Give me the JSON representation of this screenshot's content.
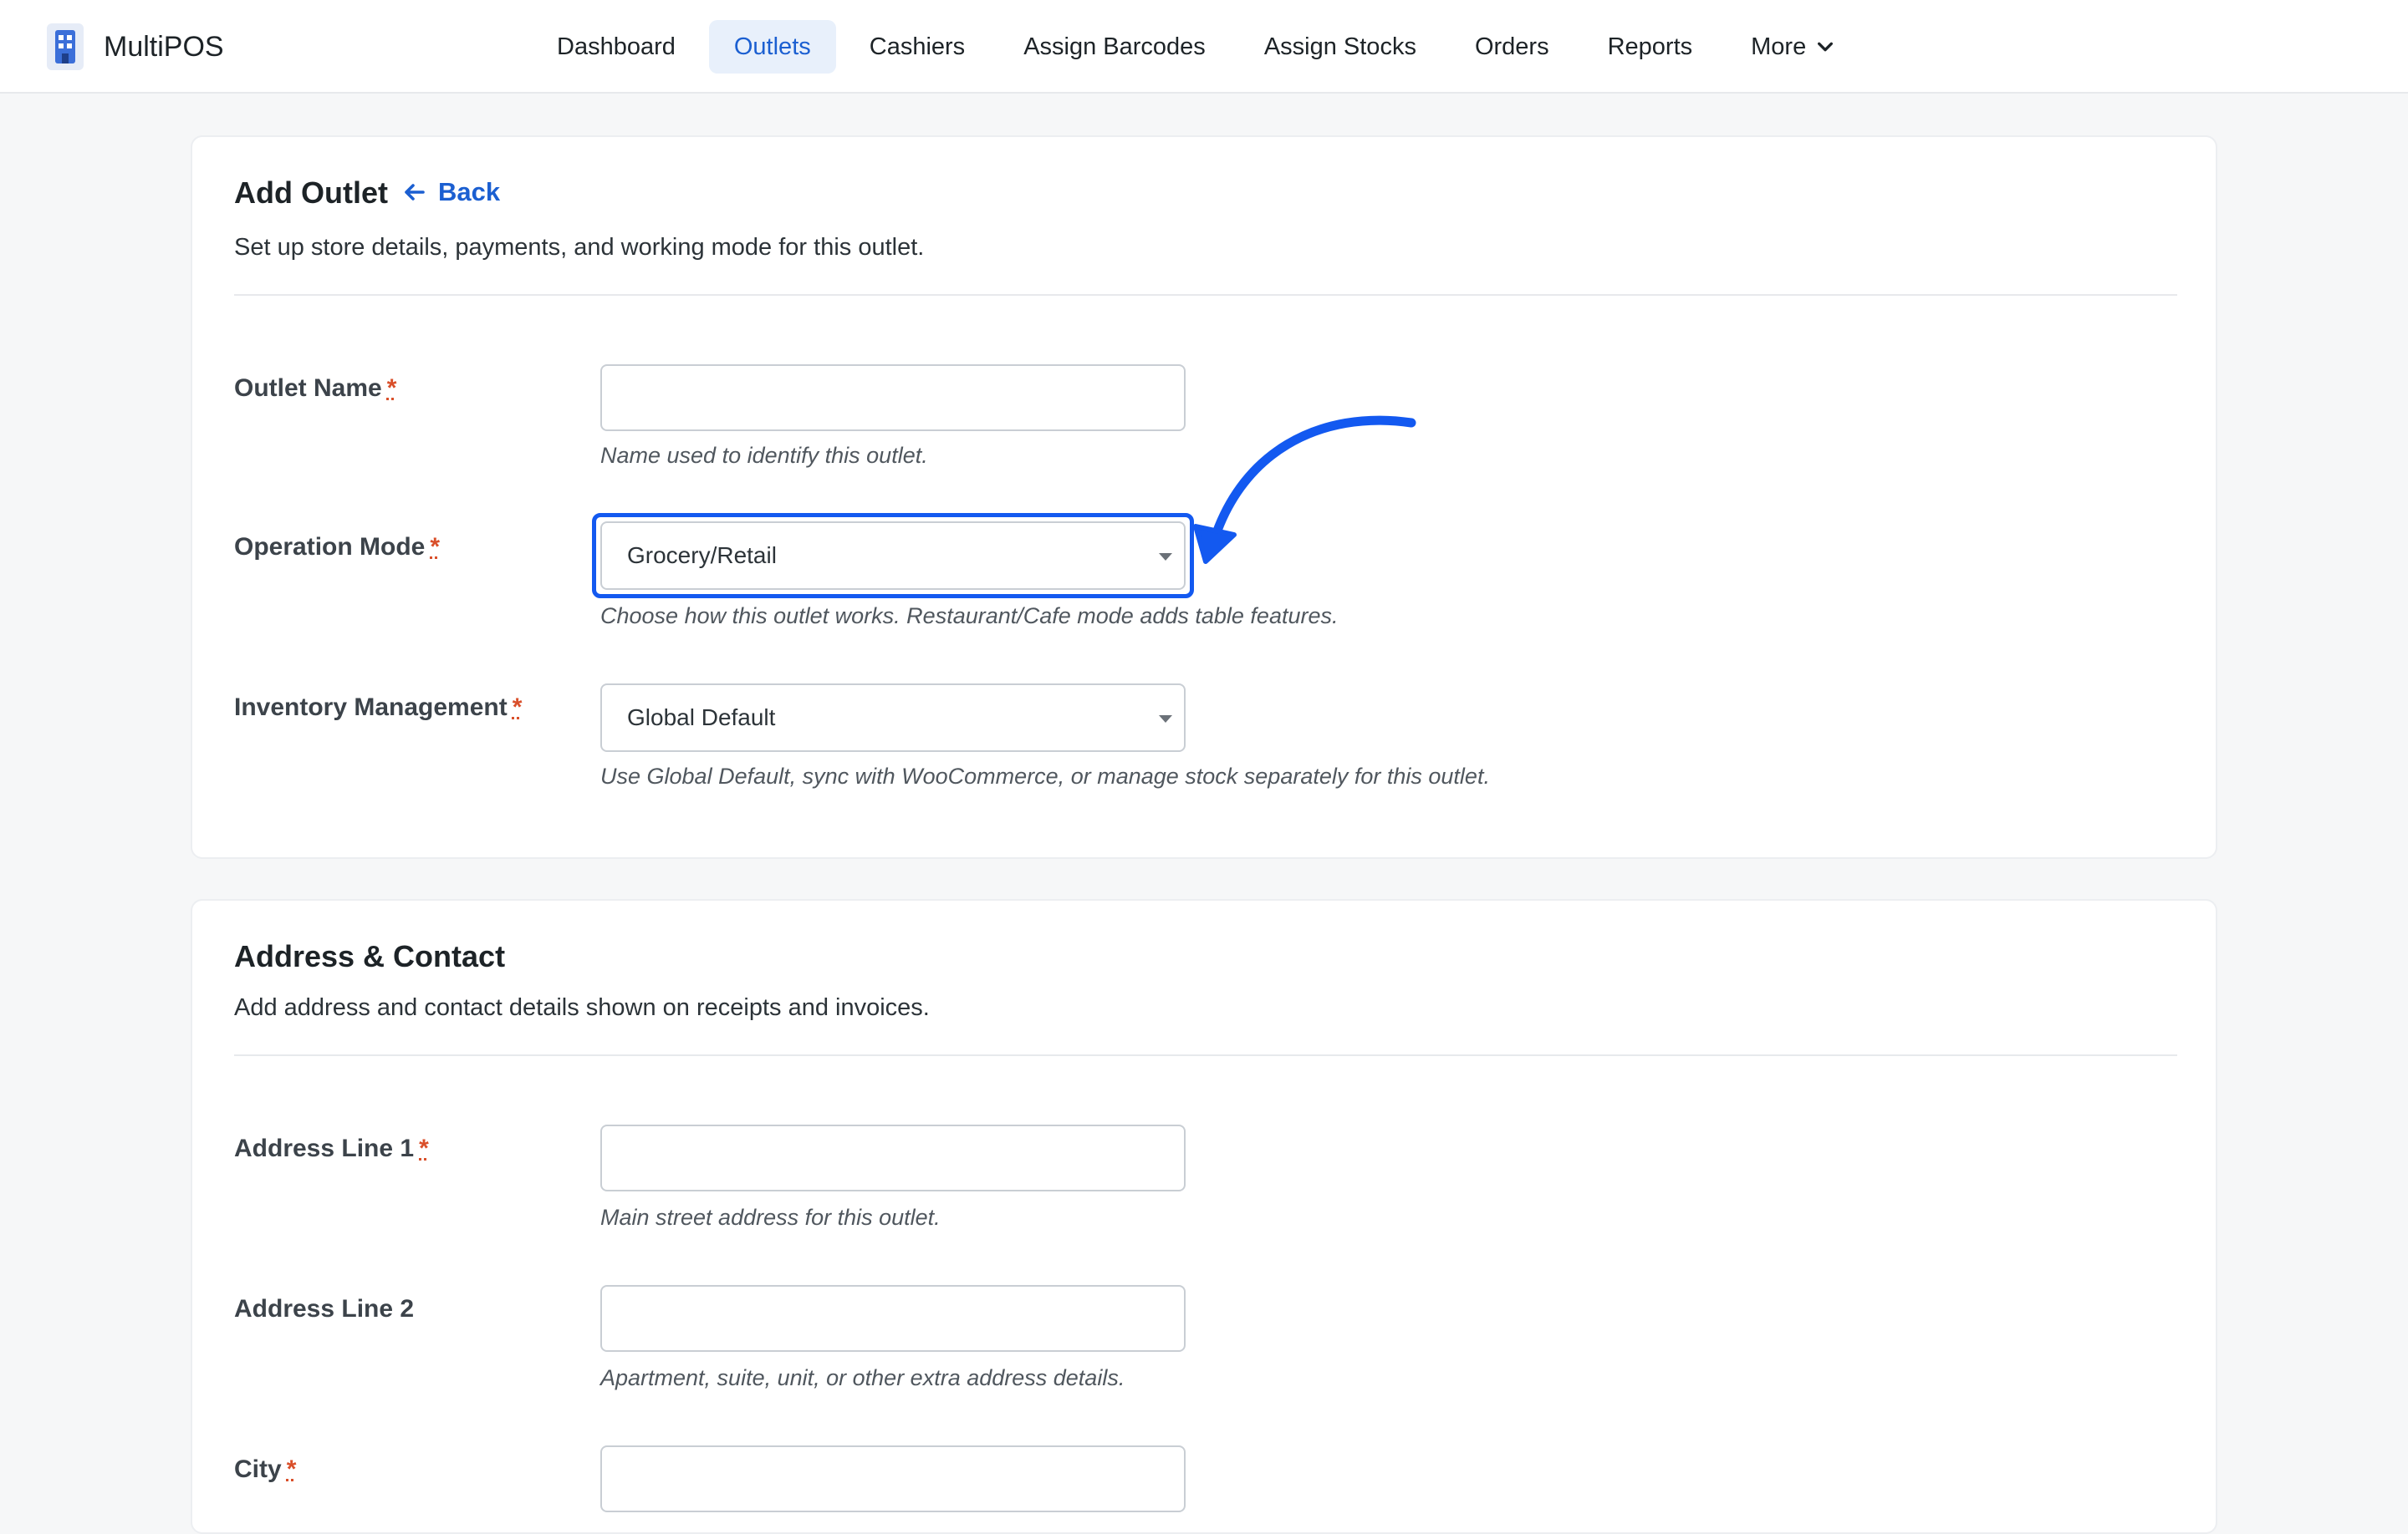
{
  "app": {
    "name": "MultiPOS",
    "logo_icon": "building-icon"
  },
  "nav": {
    "items": [
      "Dashboard",
      "Outlets",
      "Cashiers",
      "Assign Barcodes",
      "Assign Stocks",
      "Orders",
      "Reports"
    ],
    "more_label": "More",
    "active": "Outlets"
  },
  "outlet_card": {
    "title": "Add Outlet",
    "back_label": "Back",
    "description": "Set up store details, payments, and working mode for this outlet.",
    "fields": {
      "outlet_name": {
        "label": "Outlet Name",
        "value": "",
        "help": "Name used to identify this outlet."
      },
      "operation_mode": {
        "label": "Operation Mode",
        "selected": "Grocery/Retail",
        "help": "Choose how this outlet works. Restaurant/Cafe mode adds table features."
      },
      "inventory": {
        "label": "Inventory Management",
        "selected": "Global Default",
        "help": "Use Global Default, sync with WooCommerce, or manage stock separately for this outlet."
      }
    }
  },
  "address_card": {
    "title": "Address & Contact",
    "description": "Add address and contact details shown on receipts and invoices.",
    "fields": {
      "address1": {
        "label": "Address Line 1",
        "value": "",
        "help": "Main street address for this outlet."
      },
      "address2": {
        "label": "Address Line 2",
        "value": "",
        "help": "Apartment, suite, unit, or other extra address details."
      },
      "city": {
        "label": "City",
        "value": ""
      }
    }
  },
  "required_marker": "*",
  "colors": {
    "accent": "#1b5fd1",
    "highlight": "#1359f0",
    "required": "#d94f2a"
  }
}
